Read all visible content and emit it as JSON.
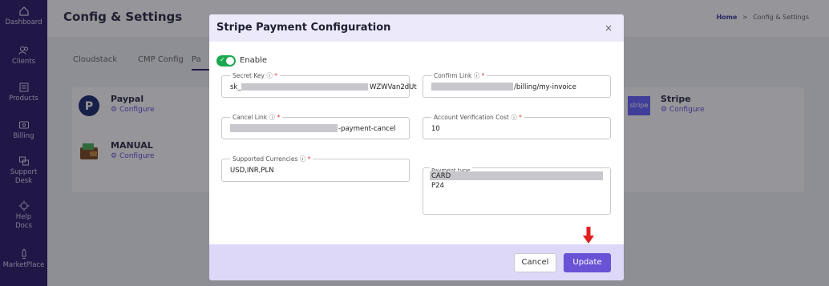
{
  "sidebar": {
    "items": [
      {
        "label": "Dashboard",
        "icon": "home-icon"
      },
      {
        "label": "Clients",
        "icon": "users-icon"
      },
      {
        "label": "Products",
        "icon": "products-icon"
      },
      {
        "label": "Billing",
        "icon": "billing-icon"
      },
      {
        "label": "Support",
        "label2": "Desk",
        "icon": "support-icon"
      },
      {
        "label": "Help",
        "label2": "Docs",
        "icon": "help-icon"
      },
      {
        "label": "MarketPlace",
        "icon": "marketplace-icon"
      }
    ]
  },
  "page": {
    "title": "Config & Settings",
    "breadcrumb": {
      "home": "Home",
      "separator": ">",
      "current": "Config & Settings"
    },
    "tabs": [
      "Cloudstack",
      "CMP Config",
      "Pa"
    ],
    "gateways": [
      {
        "name": "Paypal",
        "link": "Configure"
      },
      {
        "name": "MANUAL",
        "link": "Configure"
      },
      {
        "name": "Stripe",
        "link": "Configure",
        "logo_text": "stripe"
      }
    ]
  },
  "modal": {
    "title": "Stripe Payment Configuration",
    "close": "×",
    "enable_label": "Enable",
    "enabled": true,
    "fields": {
      "secret_key": {
        "label": "Secret Key",
        "value_start": "sk_",
        "value_end": "WZWVan2dUt"
      },
      "confirm_link": {
        "label": "Confirm Link",
        "value_end": "/billing/my-invoice"
      },
      "cancel_link": {
        "label": "Cancel Link",
        "value_end": "-payment-cancel"
      },
      "account_verification_cost": {
        "label": "Account Verification Cost",
        "value": "10"
      },
      "supported_currencies": {
        "label": "Supported Currencies",
        "value": "USD,INR,PLN"
      },
      "payment_type": {
        "label": "Payment type",
        "options": [
          "CARD",
          "P24"
        ]
      }
    },
    "info_glyph": "ⓘ",
    "required_marker": "*",
    "buttons": {
      "cancel": "Cancel",
      "update": "Update"
    }
  },
  "colors": {
    "sidebar_bg": "#2c1a66",
    "accent": "#6a52d6",
    "toggle_on": "#1aa84f",
    "arrow": "#e0201c"
  }
}
